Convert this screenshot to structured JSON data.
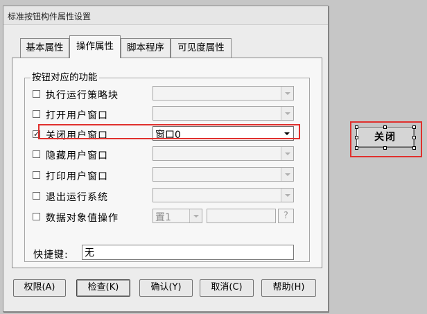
{
  "window": {
    "title": "标准按钮构件属性设置"
  },
  "tabs": [
    {
      "label": "基本属性"
    },
    {
      "label": "操作属性"
    },
    {
      "label": "脚本程序"
    },
    {
      "label": "可见度属性"
    }
  ],
  "group": {
    "title": "按钮对应的功能",
    "rows": [
      {
        "label": "执行运行策略块",
        "checked": false,
        "value": ""
      },
      {
        "label": "打开用户窗口",
        "checked": false,
        "value": ""
      },
      {
        "label": "关闭用户窗口",
        "checked": true,
        "check_mark": "✓",
        "value": "窗口0"
      },
      {
        "label": "隐藏用户窗口",
        "checked": false,
        "value": ""
      },
      {
        "label": "打印用户窗口",
        "checked": false,
        "value": ""
      },
      {
        "label": "退出运行系统",
        "checked": false,
        "value": ""
      },
      {
        "label": "数据对象值操作",
        "checked": false,
        "op_value": "置1",
        "help_label": "?"
      }
    ]
  },
  "shortcut": {
    "label": "快捷键:",
    "value": "无"
  },
  "buttons": [
    {
      "label": "权限(A)"
    },
    {
      "label": "检查(K)"
    },
    {
      "label": "确认(Y)"
    },
    {
      "label": "取消(C)"
    },
    {
      "label": "帮助(H)"
    }
  ],
  "canvas_button": {
    "label": "关闭"
  },
  "colors": {
    "highlight": "#e0302d",
    "dialog_bg": "#ececec",
    "canvas_bg": "#c6c6c6"
  }
}
